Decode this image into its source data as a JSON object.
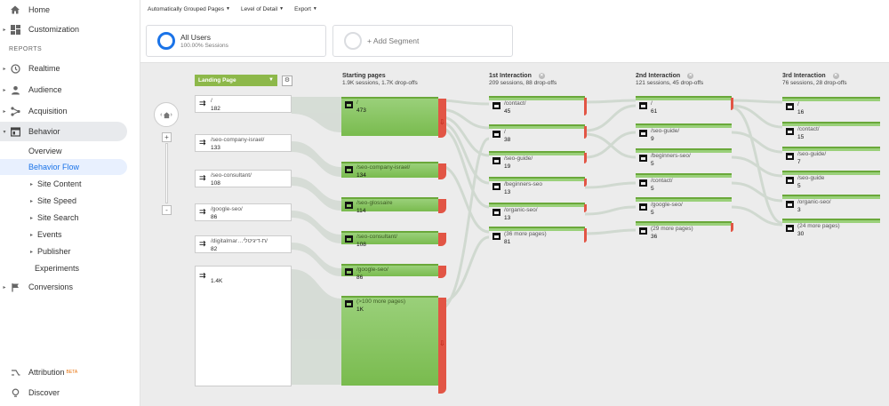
{
  "sidebar": {
    "top_items": [
      {
        "label": "Home",
        "icon": "home-icon"
      },
      {
        "label": "Customization",
        "icon": "dashboard-icon"
      }
    ],
    "reports_heading": "REPORTS",
    "report_items": [
      {
        "label": "Realtime",
        "icon": "clock-icon"
      },
      {
        "label": "Audience",
        "icon": "person-icon"
      },
      {
        "label": "Acquisition",
        "icon": "acquisition-icon"
      },
      {
        "label": "Behavior",
        "icon": "behavior-icon"
      }
    ],
    "behavior_sub": [
      {
        "label": "Overview"
      },
      {
        "label": "Behavior Flow"
      },
      {
        "label": "Site Content"
      },
      {
        "label": "Site Speed"
      },
      {
        "label": "Site Search"
      },
      {
        "label": "Events"
      },
      {
        "label": "Publisher"
      },
      {
        "label": "Experiments"
      }
    ],
    "conversions": "Conversions",
    "attribution": "Attribution",
    "attribution_badge": "BETA",
    "discover": "Discover"
  },
  "toolbar": {
    "grouped": "Automatically Grouped Pages",
    "detail": "Level of Detail",
    "export": "Export"
  },
  "segments": {
    "all_users": "All Users",
    "all_users_pct": "100.00% Sessions",
    "add_segment": "+ Add Segment"
  },
  "flow": {
    "dimension": "Landing Page",
    "columns": [
      {
        "title": "Starting pages",
        "stats": "1.9K sessions, 1.7K drop-offs"
      },
      {
        "title": "1st Interaction",
        "stats": "209 sessions, 88 drop-offs"
      },
      {
        "title": "2nd Interaction",
        "stats": "121 sessions, 45 drop-offs"
      },
      {
        "title": "3rd Interaction",
        "stats": "76 sessions, 28 drop-offs"
      }
    ],
    "landing": [
      {
        "name": "/",
        "count": "182"
      },
      {
        "name": "/seo-company-israel/",
        "count": "133"
      },
      {
        "name": "/seo-consultant/",
        "count": "108"
      },
      {
        "name": "/google-seo/",
        "count": "86"
      },
      {
        "name": "/digitalmar…ת-דיגיטלי/",
        "count": "82"
      },
      {
        "name": "",
        "count": "1.4K"
      }
    ],
    "starting": [
      {
        "name": "/",
        "count": "473"
      },
      {
        "name": "/seo-company-israel/",
        "count": "134"
      },
      {
        "name": "/seo-glossaire",
        "count": "114"
      },
      {
        "name": "/seo-consultant/",
        "count": "108"
      },
      {
        "name": "/google-seo/",
        "count": "86"
      },
      {
        "name": "(>100 more pages)",
        "count": "1K"
      }
    ],
    "first": [
      {
        "name": "/contact/",
        "count": "45"
      },
      {
        "name": "/",
        "count": "38"
      },
      {
        "name": "/seo-guide/",
        "count": "19"
      },
      {
        "name": "/beginners-seo",
        "count": "13"
      },
      {
        "name": "/organic-seo/",
        "count": "13"
      },
      {
        "name": "(36 more pages)",
        "count": "81"
      }
    ],
    "second": [
      {
        "name": "/",
        "count": "61"
      },
      {
        "name": "/seo-guide/",
        "count": "9"
      },
      {
        "name": "/beginners-seo/",
        "count": "5"
      },
      {
        "name": "/contact/",
        "count": "5"
      },
      {
        "name": "/google-seo/",
        "count": "5"
      },
      {
        "name": "(29 more pages)",
        "count": "36"
      }
    ],
    "third": [
      {
        "name": "/",
        "count": "16"
      },
      {
        "name": "/contact/",
        "count": "15"
      },
      {
        "name": "/seo-guide/",
        "count": "7"
      },
      {
        "name": "/seo-guide",
        "count": "5"
      },
      {
        "name": "/organic-seo/",
        "count": "3"
      },
      {
        "name": "(24 more pages)",
        "count": "30"
      }
    ]
  },
  "colors": {
    "accent": "#1a73e8",
    "node_green": "#8cc665",
    "dropoff_red": "#e25545",
    "canvas": "#ececec"
  }
}
